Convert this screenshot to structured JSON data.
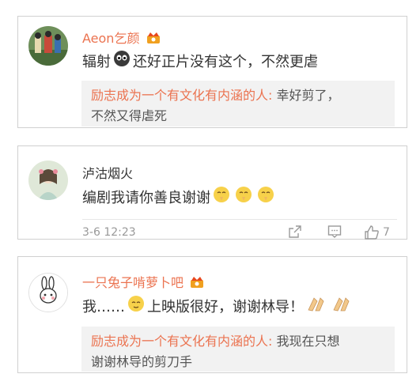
{
  "comments": [
    {
      "username": "Aeon乞颜",
      "text_before": "辐射",
      "text_after": "还好正片没有这个，不然更虐",
      "quote_name": "励志成为一个有文化有内涵的人:",
      "quote_text": "幸好剪了，",
      "quote_text2": "不然又得虐死"
    },
    {
      "username": "泸沽烟火",
      "text": "编剧我请你善良谢谢",
      "time": "3-6 12:23",
      "like_count": "7"
    },
    {
      "username": "一只兔子啃萝卜吧",
      "text_before": "我……",
      "text_after": "上映版很好，谢谢林导！",
      "quote_name": "励志成为一个有文化有内涵的人:",
      "quote_text": "我现在只想",
      "quote_text2": "谢谢林导的剪刀手"
    }
  ],
  "icons": {
    "crown": "crown-badge-icon",
    "alien": "alien-emoji-icon",
    "pray": "pray-emoji-icon",
    "smile": "smile-emoji-icon",
    "clap": "clap-emoji-icon",
    "share": "share-icon",
    "comment": "comment-icon",
    "like": "thumbs-up-icon"
  }
}
